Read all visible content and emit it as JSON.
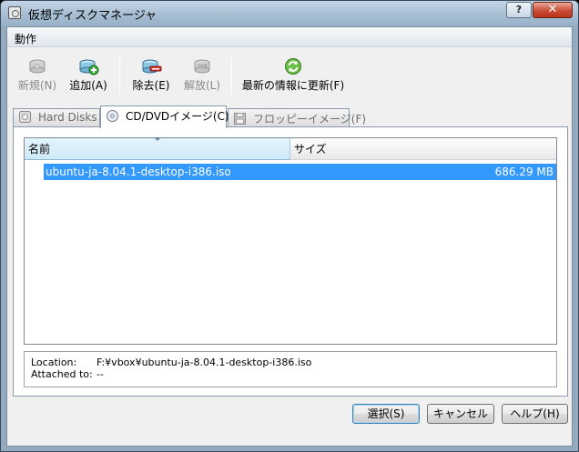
{
  "window": {
    "title": "仮想ディスクマネージャ",
    "help": "?",
    "close": "✕"
  },
  "menu": {
    "items": [
      "動作"
    ]
  },
  "toolbar": {
    "new": {
      "label": "新規(N)",
      "enabled": false,
      "icon": "disk-new-icon"
    },
    "add": {
      "label": "追加(A)",
      "enabled": true,
      "icon": "disk-add-icon"
    },
    "remove": {
      "label": "除去(E)",
      "enabled": true,
      "icon": "disk-remove-icon"
    },
    "release": {
      "label": "解放(L)",
      "enabled": false,
      "icon": "disk-release-icon"
    },
    "refresh": {
      "label": "最新の情報に更新(F)",
      "enabled": true,
      "icon": "refresh-icon"
    }
  },
  "tabs": [
    {
      "label": "Hard Disks",
      "active": false,
      "icon": "hard-disk-icon"
    },
    {
      "label": "CD/DVDイメージ(C)",
      "active": true,
      "icon": "cd-icon"
    },
    {
      "label": "フロッピーイメージ(F)",
      "active": false,
      "icon": "floppy-icon"
    }
  ],
  "list": {
    "columns": [
      "名前",
      "サイズ"
    ],
    "rows": [
      {
        "name": "ubuntu-ja-8.04.1-desktop-i386.iso",
        "size": "686.29 MB",
        "selected": true
      }
    ]
  },
  "details": {
    "location_label": "Location:",
    "location_value": "F:¥vbox¥ubuntu-ja-8.04.1-desktop-i386.iso",
    "attached_label": "Attached to:",
    "attached_value": "--"
  },
  "buttons": {
    "select": "選択(S)",
    "cancel": "キャンセル",
    "help": "ヘルプ(H)"
  },
  "colors": {
    "selection": "#3399ff",
    "titlebar": "#a6bdd2",
    "close": "#c94c33"
  }
}
